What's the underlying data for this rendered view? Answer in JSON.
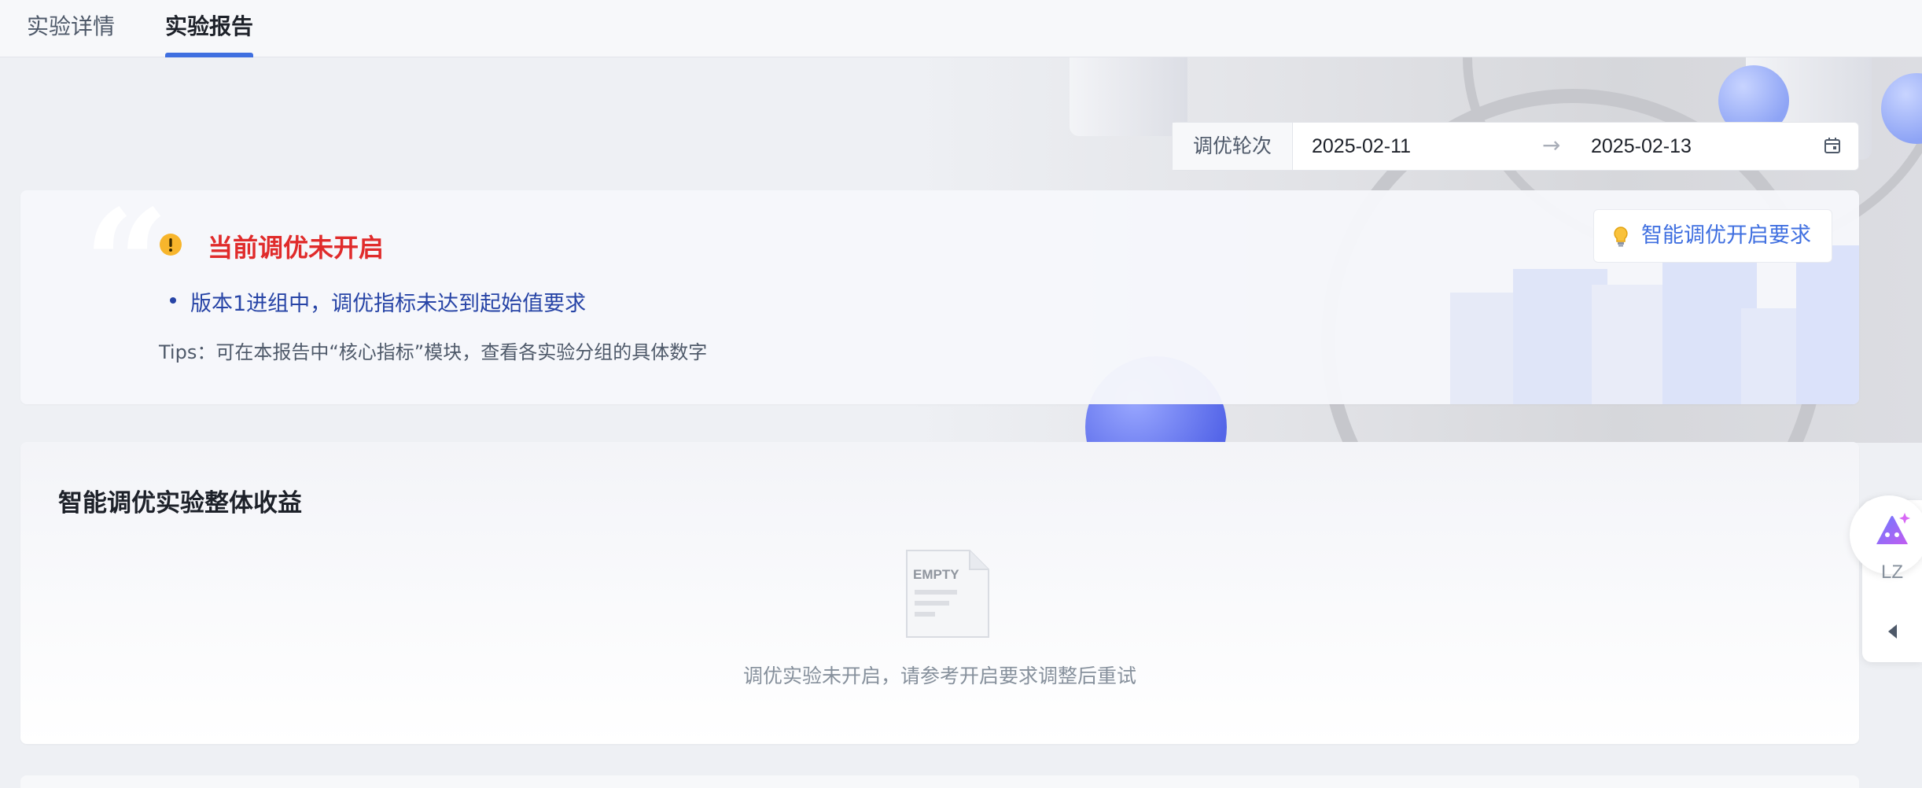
{
  "tabs": [
    {
      "label": "实验详情",
      "active": false
    },
    {
      "label": "实验报告",
      "active": true
    }
  ],
  "range": {
    "label": "调优轮次",
    "start": "2025-02-11",
    "separator": "→",
    "end": "2025-02-13"
  },
  "status": {
    "title": "当前调优未开启",
    "bullet": "版本1进组中，调优指标未达到起始值要求",
    "tips": "Tips：可在本报告中“核心指标”模块，查看各实验分组的具体数字",
    "requirement_button": "智能调优开启要求",
    "title_color": "#e02b2b",
    "accent_color": "#3f6fe0"
  },
  "benefit": {
    "title": "智能调优实验整体收益",
    "empty_badge": "EMPTY",
    "empty_text": "调优实验未开启，请参考开启要求调整后重试"
  },
  "side_widget": {
    "label": "LZ"
  }
}
